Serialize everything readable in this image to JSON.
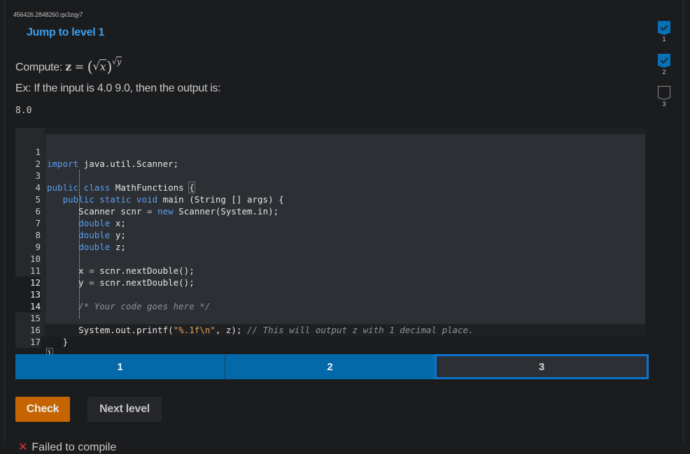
{
  "activity_id": "456426.2848260.qx3zqy7",
  "jump_link": "Jump to level 1",
  "prompt": {
    "label": "Compute: ",
    "formula_lhs": "z",
    "equals": "=",
    "base_var": "x",
    "exponent_var": "y"
  },
  "example": {
    "text": "Ex: If the input is 4.0 9.0, then the output is:",
    "output": "8.0"
  },
  "editor": {
    "lines": [
      {
        "n": "1"
      },
      {
        "n": "2"
      },
      {
        "n": "3"
      },
      {
        "n": "4"
      },
      {
        "n": "5"
      },
      {
        "n": "6"
      },
      {
        "n": "7"
      },
      {
        "n": "8"
      },
      {
        "n": "9"
      },
      {
        "n": "10"
      },
      {
        "n": "11"
      },
      {
        "n": "12"
      },
      {
        "n": "13"
      },
      {
        "n": "14"
      },
      {
        "n": "15"
      },
      {
        "n": "16"
      },
      {
        "n": "17"
      }
    ],
    "tokens": {
      "l1_kw": "import",
      "l1_rest": " java.util.Scanner;",
      "l3_kw": "public class",
      "l3_rest": " MathFunctions ",
      "l3_brace": "{",
      "l4_indent": "   ",
      "l4_kw": "public static void",
      "l4_rest": " main (String [] args) {",
      "l5_indent": "      ",
      "l5_a": "Scanner scnr ",
      "l5_op": "=",
      "l5_sp": " ",
      "l5_kw": "new",
      "l5_rest": " Scanner(System.in);",
      "l6_indent": "      ",
      "l6_kw": "double",
      "l6_rest": " x;",
      "l7_indent": "      ",
      "l7_kw": "double",
      "l7_rest": " y;",
      "l8_indent": "      ",
      "l8_kw": "double",
      "l8_rest": " z;",
      "l10_indent": "      ",
      "l10_a": "x ",
      "l10_op": "=",
      "l10_rest": " scnr.nextDouble();",
      "l11_indent": "      ",
      "l11_a": "y ",
      "l11_op": "=",
      "l11_rest": " scnr.nextDouble();",
      "l13_indent": "      ",
      "l13_cm": "/* Your code goes here */",
      "l15_indent": "      ",
      "l15_a": "System.out.printf(",
      "l15_str": "\"%.1f\\n\"",
      "l15_b": ", z); ",
      "l15_cm": "// This will output z with 1 decimal place.",
      "l16_indent": "   ",
      "l16_rest": "}",
      "l17_rest": "}"
    }
  },
  "levels_bar": {
    "segments": [
      {
        "label": "1",
        "state": "completed"
      },
      {
        "label": "2",
        "state": "completed"
      },
      {
        "label": "3",
        "state": "current"
      }
    ]
  },
  "buttons": {
    "check": "Check",
    "next_level": "Next level"
  },
  "feedback": {
    "icon": "error-x-icon",
    "text": "Failed to compile"
  },
  "level_tracker": {
    "items": [
      {
        "label": "1",
        "state": "completed"
      },
      {
        "label": "2",
        "state": "completed"
      },
      {
        "label": "3",
        "state": "incomplete"
      }
    ]
  },
  "colors": {
    "accent_blue": "#0369a8",
    "link_blue": "#3aa0f0",
    "check_orange": "#c56400",
    "current_border": "#0b74d0"
  }
}
